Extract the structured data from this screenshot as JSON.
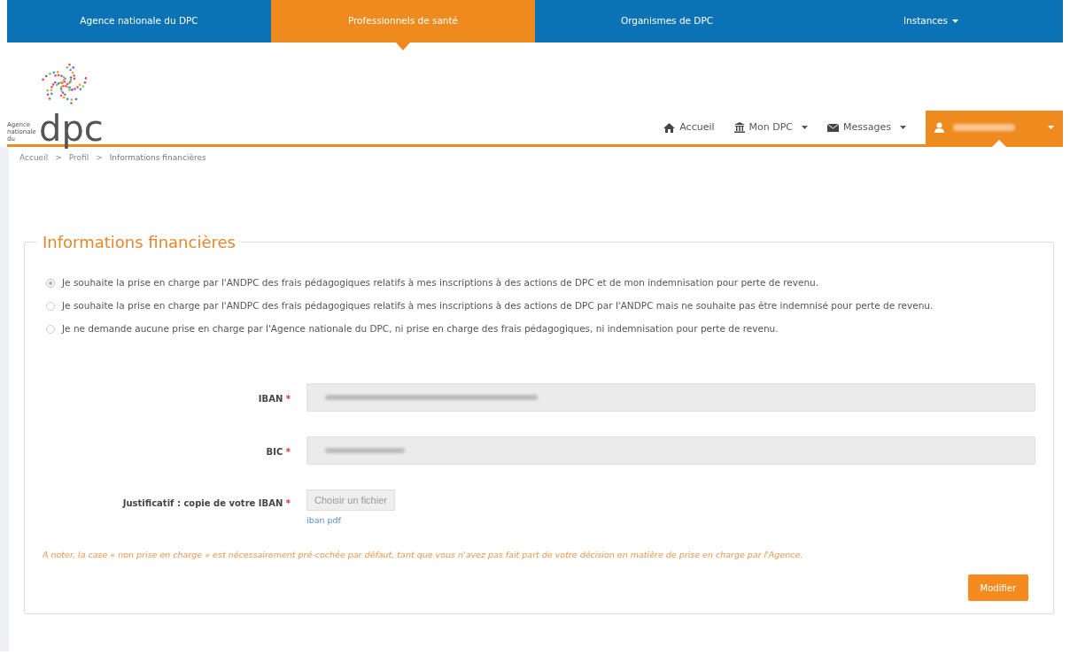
{
  "top_nav": [
    {
      "label": "Agence nationale du DPC",
      "selected": false,
      "dropdown": false
    },
    {
      "label": "Professionnels de santé",
      "selected": true,
      "dropdown": false
    },
    {
      "label": "Organismes de DPC",
      "selected": false,
      "dropdown": false
    },
    {
      "label": "Instances",
      "selected": false,
      "dropdown": true
    }
  ],
  "logo": {
    "small_text": "Agence nationale du",
    "big_text": "dpc"
  },
  "main_nav": [
    {
      "label": "Accueil",
      "dropdown": false
    },
    {
      "label": "Mon DPC",
      "dropdown": true
    },
    {
      "label": "Messages",
      "dropdown": true
    }
  ],
  "user_menu": {
    "dropdown": true
  },
  "breadcrumb": {
    "separator": ">",
    "items": [
      "Accueil",
      "Profil",
      "Informations financières"
    ]
  },
  "section": {
    "title": "Informations financières",
    "options": [
      {
        "label": "Je souhaite la prise en charge par l'ANDPC des frais pédagogiques relatifs à mes inscriptions à des actions de DPC et de mon indemnisation pour perte de revenu.",
        "selected": true
      },
      {
        "label": "Je souhaite la prise en charge par l'ANDPC des frais pédagogiques relatifs à mes inscriptions à des actions de DPC par l'ANDPC mais ne souhaite pas être indemnisé pour perte de revenu.",
        "selected": false
      },
      {
        "label": "Je ne demande aucune prise en charge par l'Agence nationale du DPC, ni prise en charge des frais pédagogiques, ni indemnisation pour perte de revenu.",
        "selected": false
      }
    ],
    "fields": [
      {
        "kind": "text",
        "label": "IBAN",
        "required": "*"
      },
      {
        "kind": "text",
        "label": "BIC",
        "required": "*"
      },
      {
        "kind": "file",
        "label": "Justificatif : copie de votre IBAN",
        "required": "*",
        "button": "Choisir un fichier",
        "link": "iban pdf"
      }
    ],
    "note": "A noter, la case « non prise en charge » est nécessairement pré-cochée par défaut, tant que vous n'avez pas fait part de votre décision en matière de prise en charge par l'Agence.",
    "submit": "Modifier"
  }
}
